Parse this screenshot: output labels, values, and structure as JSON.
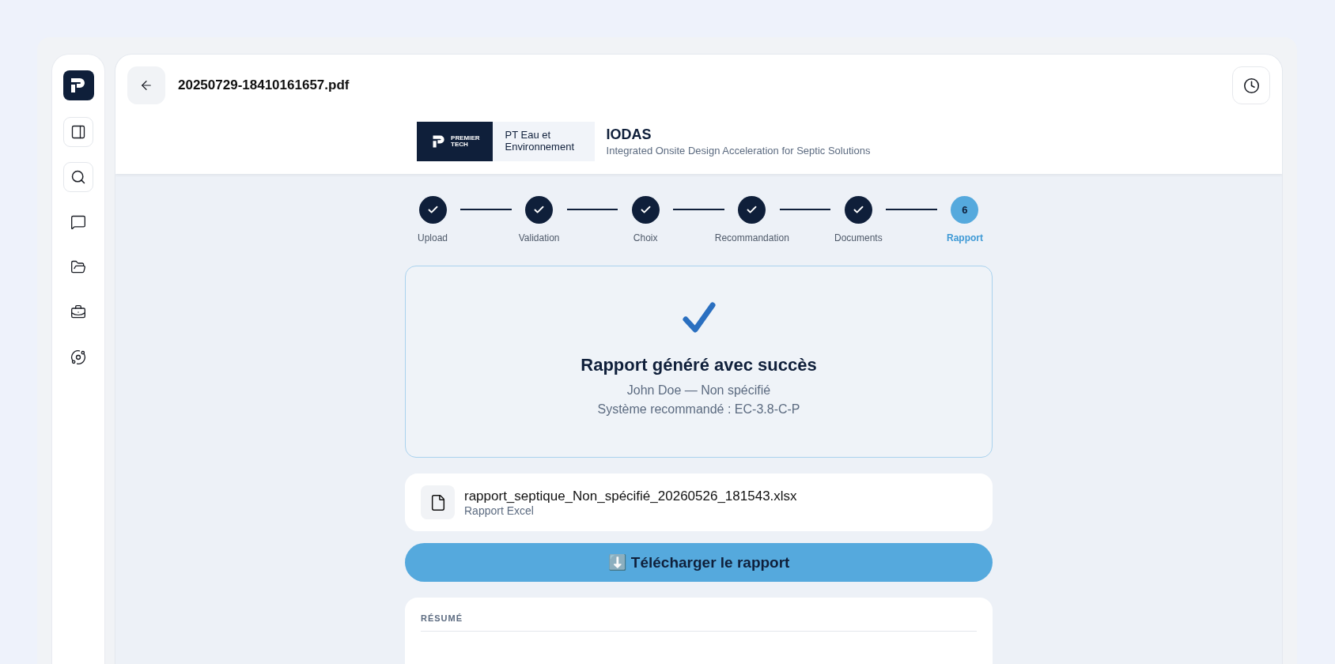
{
  "sidebar": {
    "items": [
      {
        "kind": "framed"
      },
      {
        "kind": "framed"
      },
      {
        "kind": "plain"
      },
      {
        "kind": "plain"
      },
      {
        "kind": "plain"
      },
      {
        "kind": "plain"
      }
    ]
  },
  "header": {
    "file_name": "20250729-18410161657.pdf"
  },
  "brand": {
    "logo_text": "PREMIER TECH",
    "division": "PT Eau et Environnement",
    "title": "IODAS",
    "subtitle": "Integrated Onsite Design Acceleration for Septic Solutions"
  },
  "steps": [
    {
      "label": "Upload",
      "done": true,
      "selected": false
    },
    {
      "label": "Validation",
      "done": true,
      "selected": false
    },
    {
      "label": "Choix",
      "done": true,
      "selected": false
    },
    {
      "label": "Recommandation",
      "done": true,
      "selected": false
    },
    {
      "label": "Documents",
      "done": true,
      "selected": false
    },
    {
      "label": "Rapport",
      "number": "6",
      "done": false,
      "selected": true
    }
  ],
  "success": {
    "title": "Rapport généré avec succès",
    "client": "John Doe — Non spécifié",
    "system": "Système recommandé : EC-3.8-C-P"
  },
  "file": {
    "name": "rapport_septique_Non_spécifié_20260526_181543.xlsx",
    "type": "Rapport Excel"
  },
  "download_button": "⬇️ Télécharger le rapport",
  "summary": {
    "heading": "RÉSUMÉ"
  }
}
